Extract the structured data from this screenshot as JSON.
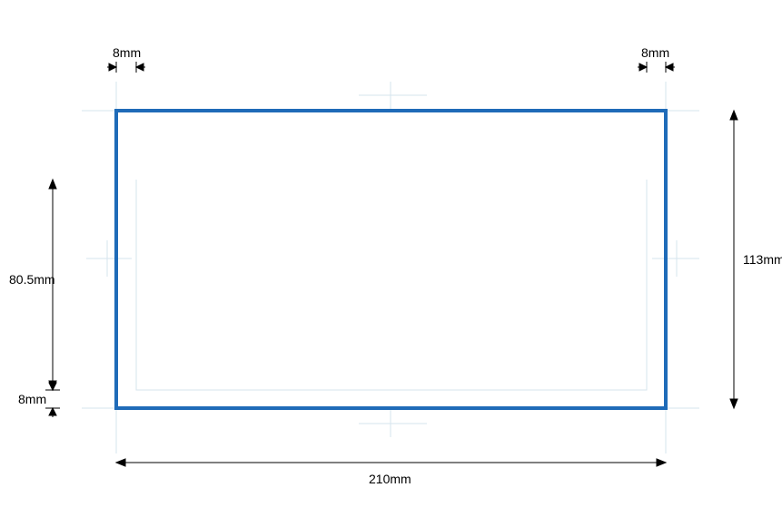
{
  "dims": {
    "width": "210mm",
    "height": "113mm",
    "inner_height": "80.5mm",
    "margin_top_left": "8mm",
    "margin_top_right": "8mm",
    "margin_bottom_left": "8mm"
  },
  "colors": {
    "outer_stroke": "#1f6bb8",
    "guide_stroke": "#d6e4ee",
    "arrow": "#000000"
  }
}
